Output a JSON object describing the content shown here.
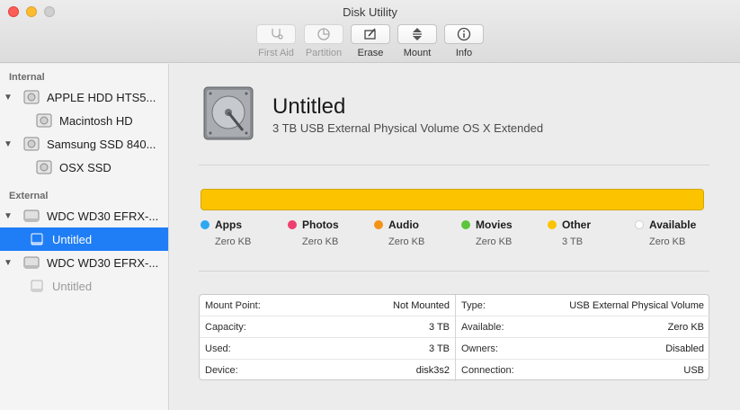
{
  "window": {
    "title": "Disk Utility"
  },
  "toolbar": {
    "first_aid": "First Aid",
    "partition": "Partition",
    "erase": "Erase",
    "mount": "Mount",
    "info": "Info"
  },
  "sidebar": {
    "internal_header": "Internal",
    "external_header": "External",
    "items": [
      {
        "label": "APPLE HDD HTS5...",
        "icon": "disk-icon"
      },
      {
        "label": "Macintosh HD",
        "icon": "volume-icon"
      },
      {
        "label": "Samsung SSD 840...",
        "icon": "disk-icon"
      },
      {
        "label": "OSX SSD",
        "icon": "volume-icon"
      },
      {
        "label": "WDC WD30 EFRX-...",
        "icon": "external-disk-icon"
      },
      {
        "label": "Untitled",
        "icon": "external-volume-icon",
        "selected": true
      },
      {
        "label": "WDC WD30 EFRX-...",
        "icon": "external-disk-icon"
      },
      {
        "label": "Untitled",
        "icon": "external-volume-icon",
        "unmounted": true
      }
    ]
  },
  "volume": {
    "name": "Untitled",
    "description": "3 TB USB External Physical Volume OS X Extended"
  },
  "usage": {
    "fill_color": "#fcc400",
    "other_fraction": 1.0,
    "legend": [
      {
        "name": "Apps",
        "value": "Zero KB",
        "color": "#2ea8f0"
      },
      {
        "name": "Photos",
        "value": "Zero KB",
        "color": "#ef3e6d"
      },
      {
        "name": "Audio",
        "value": "Zero KB",
        "color": "#f39316"
      },
      {
        "name": "Movies",
        "value": "Zero KB",
        "color": "#5cc63b"
      },
      {
        "name": "Other",
        "value": "3 TB",
        "color": "#fcc400"
      },
      {
        "name": "Available",
        "value": "Zero KB",
        "color": "#ffffff"
      }
    ]
  },
  "info": {
    "left": [
      {
        "key": "Mount Point:",
        "value": "Not Mounted"
      },
      {
        "key": "Capacity:",
        "value": "3 TB"
      },
      {
        "key": "Used:",
        "value": "3 TB"
      },
      {
        "key": "Device:",
        "value": "disk3s2"
      }
    ],
    "right": [
      {
        "key": "Type:",
        "value": "USB External Physical Volume"
      },
      {
        "key": "Available:",
        "value": "Zero KB"
      },
      {
        "key": "Owners:",
        "value": "Disabled"
      },
      {
        "key": "Connection:",
        "value": "USB"
      }
    ]
  }
}
